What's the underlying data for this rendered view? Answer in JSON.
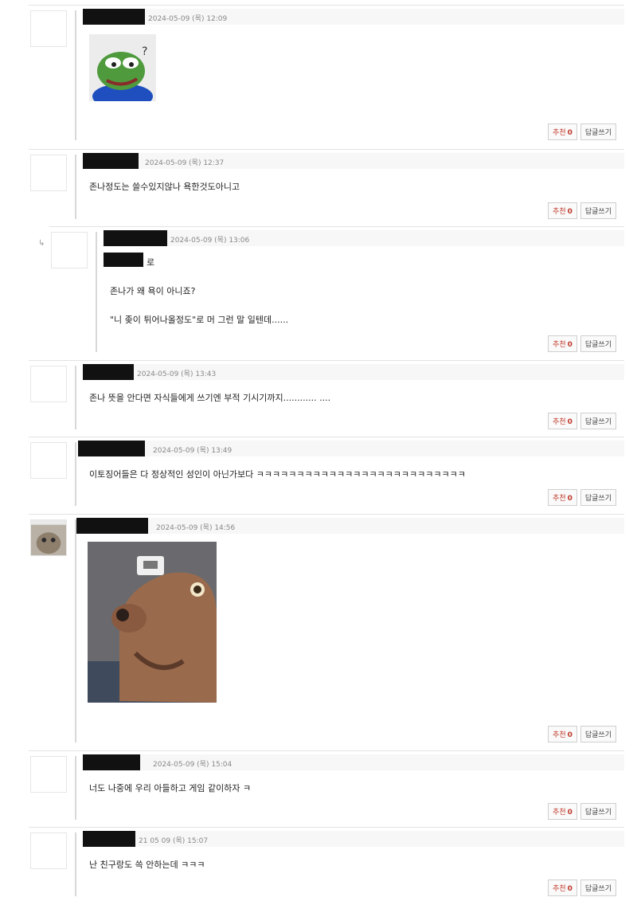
{
  "comments": [
    {
      "date": "2024-05-09 (목) 12:09",
      "text": ""
    },
    {
      "date": "2024-05-09 (목) 12:37",
      "text": "존나정도는 쓸수있지않나 욕한것도아니고"
    },
    {
      "date": "2024-05-09 (목) 13:06",
      "line1": "로",
      "line2": "존나가 왜 욕이 아니죠?",
      "line3": "\"니 좆이 튀어나올정도\"로 머 그런 말 일텐데......"
    },
    {
      "date": "2024-05-09 (목) 13:43",
      "text": "존나 뜻을 안다면 자식들에게 쓰기엔 부적 기시기까지............ ...."
    },
    {
      "date": "2024-05-09 (목) 13:49",
      "text": "이토징어들은 다 정상적인 성인이 아닌가보다 ㅋㅋㅋㅋㅋㅋㅋㅋㅋㅋㅋㅋㅋㅋㅋㅋㅋㅋㅋㅋㅋㅋㅋㅋㅋㅋ"
    },
    {
      "date": "2024-05-09 (목) 14:56",
      "text": ""
    },
    {
      "date": "2024-05-09 (목) 15:04",
      "text": "너도 나중에 우리 아들하고 게임 같이하자 ㅋ"
    },
    {
      "date": "21 05 09 (목) 15:07",
      "text": "난 친구랑도 쓱 안하는데 ㅋㅋㅋ"
    }
  ],
  "buttons": {
    "recommend": "추천",
    "count": "0",
    "reply": "답글쓰기"
  },
  "reply_mark": "↳"
}
